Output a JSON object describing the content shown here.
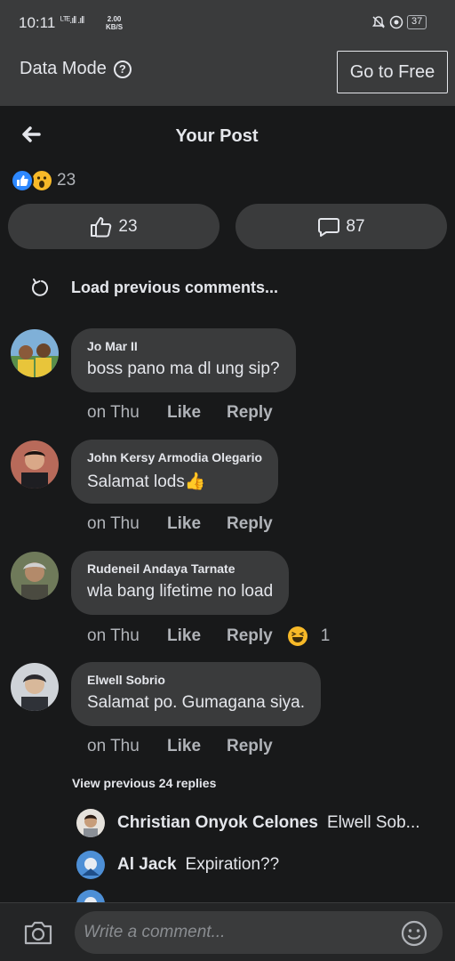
{
  "status_bar": {
    "time": "10:11",
    "signal": "ᴸᵀᴱ.ıll .ıll",
    "speed_value": "2.00",
    "speed_unit": "KB/S",
    "battery": "37"
  },
  "data_bar": {
    "label": "Data Mode",
    "help": "?",
    "go_free": "Go to Free"
  },
  "header": {
    "title": "Your Post"
  },
  "reactions": {
    "count": "23"
  },
  "action_pills": {
    "like_count": "23",
    "comment_count": "87"
  },
  "load_previous": "Load previous comments...",
  "comments": [
    {
      "name": "Jo Mar II",
      "text": "boss pano ma dl ung sip?",
      "time": "on Thu",
      "like": "Like",
      "reply": "Reply"
    },
    {
      "name": "John Kersy Armodia Olegario",
      "text": "Salamat lods👍",
      "time": "on Thu",
      "like": "Like",
      "reply": "Reply"
    },
    {
      "name": "Rudeneil Andaya Tarnate",
      "text": "wla bang lifetime no load",
      "time": "on Thu",
      "like": "Like",
      "reply": "Reply",
      "reaction_count": "1"
    },
    {
      "name": "Elwell Sobrio",
      "text": "Salamat po. Gumagana siya.",
      "time": "on Thu",
      "like": "Like",
      "reply": "Reply"
    }
  ],
  "view_replies": "View previous 24 replies",
  "replies": [
    {
      "name": "Christian Onyok Celones",
      "text": "Elwell Sob..."
    },
    {
      "name": "Al Jack",
      "text": "Expiration??"
    }
  ],
  "composer": {
    "placeholder": "Write a comment..."
  },
  "colors": {
    "background": "#18191a",
    "surface": "#3a3b3c",
    "text": "#e4e6eb",
    "secondary_text": "#b0b3b8",
    "like_blue": "#2d88ff",
    "wow_yellow": "#f7b928"
  }
}
